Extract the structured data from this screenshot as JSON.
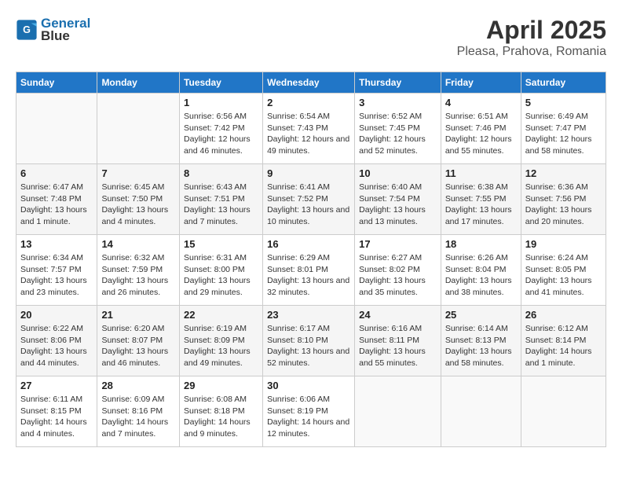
{
  "header": {
    "logo_line1": "General",
    "logo_line2": "Blue",
    "title": "April 2025",
    "subtitle": "Pleasa, Prahova, Romania"
  },
  "calendar": {
    "days_of_week": [
      "Sunday",
      "Monday",
      "Tuesday",
      "Wednesday",
      "Thursday",
      "Friday",
      "Saturday"
    ],
    "weeks": [
      [
        {
          "day": "",
          "info": ""
        },
        {
          "day": "",
          "info": ""
        },
        {
          "day": "1",
          "info": "Sunrise: 6:56 AM\nSunset: 7:42 PM\nDaylight: 12 hours and 46 minutes."
        },
        {
          "day": "2",
          "info": "Sunrise: 6:54 AM\nSunset: 7:43 PM\nDaylight: 12 hours and 49 minutes."
        },
        {
          "day": "3",
          "info": "Sunrise: 6:52 AM\nSunset: 7:45 PM\nDaylight: 12 hours and 52 minutes."
        },
        {
          "day": "4",
          "info": "Sunrise: 6:51 AM\nSunset: 7:46 PM\nDaylight: 12 hours and 55 minutes."
        },
        {
          "day": "5",
          "info": "Sunrise: 6:49 AM\nSunset: 7:47 PM\nDaylight: 12 hours and 58 minutes."
        }
      ],
      [
        {
          "day": "6",
          "info": "Sunrise: 6:47 AM\nSunset: 7:48 PM\nDaylight: 13 hours and 1 minute."
        },
        {
          "day": "7",
          "info": "Sunrise: 6:45 AM\nSunset: 7:50 PM\nDaylight: 13 hours and 4 minutes."
        },
        {
          "day": "8",
          "info": "Sunrise: 6:43 AM\nSunset: 7:51 PM\nDaylight: 13 hours and 7 minutes."
        },
        {
          "day": "9",
          "info": "Sunrise: 6:41 AM\nSunset: 7:52 PM\nDaylight: 13 hours and 10 minutes."
        },
        {
          "day": "10",
          "info": "Sunrise: 6:40 AM\nSunset: 7:54 PM\nDaylight: 13 hours and 13 minutes."
        },
        {
          "day": "11",
          "info": "Sunrise: 6:38 AM\nSunset: 7:55 PM\nDaylight: 13 hours and 17 minutes."
        },
        {
          "day": "12",
          "info": "Sunrise: 6:36 AM\nSunset: 7:56 PM\nDaylight: 13 hours and 20 minutes."
        }
      ],
      [
        {
          "day": "13",
          "info": "Sunrise: 6:34 AM\nSunset: 7:57 PM\nDaylight: 13 hours and 23 minutes."
        },
        {
          "day": "14",
          "info": "Sunrise: 6:32 AM\nSunset: 7:59 PM\nDaylight: 13 hours and 26 minutes."
        },
        {
          "day": "15",
          "info": "Sunrise: 6:31 AM\nSunset: 8:00 PM\nDaylight: 13 hours and 29 minutes."
        },
        {
          "day": "16",
          "info": "Sunrise: 6:29 AM\nSunset: 8:01 PM\nDaylight: 13 hours and 32 minutes."
        },
        {
          "day": "17",
          "info": "Sunrise: 6:27 AM\nSunset: 8:02 PM\nDaylight: 13 hours and 35 minutes."
        },
        {
          "day": "18",
          "info": "Sunrise: 6:26 AM\nSunset: 8:04 PM\nDaylight: 13 hours and 38 minutes."
        },
        {
          "day": "19",
          "info": "Sunrise: 6:24 AM\nSunset: 8:05 PM\nDaylight: 13 hours and 41 minutes."
        }
      ],
      [
        {
          "day": "20",
          "info": "Sunrise: 6:22 AM\nSunset: 8:06 PM\nDaylight: 13 hours and 44 minutes."
        },
        {
          "day": "21",
          "info": "Sunrise: 6:20 AM\nSunset: 8:07 PM\nDaylight: 13 hours and 46 minutes."
        },
        {
          "day": "22",
          "info": "Sunrise: 6:19 AM\nSunset: 8:09 PM\nDaylight: 13 hours and 49 minutes."
        },
        {
          "day": "23",
          "info": "Sunrise: 6:17 AM\nSunset: 8:10 PM\nDaylight: 13 hours and 52 minutes."
        },
        {
          "day": "24",
          "info": "Sunrise: 6:16 AM\nSunset: 8:11 PM\nDaylight: 13 hours and 55 minutes."
        },
        {
          "day": "25",
          "info": "Sunrise: 6:14 AM\nSunset: 8:13 PM\nDaylight: 13 hours and 58 minutes."
        },
        {
          "day": "26",
          "info": "Sunrise: 6:12 AM\nSunset: 8:14 PM\nDaylight: 14 hours and 1 minute."
        }
      ],
      [
        {
          "day": "27",
          "info": "Sunrise: 6:11 AM\nSunset: 8:15 PM\nDaylight: 14 hours and 4 minutes."
        },
        {
          "day": "28",
          "info": "Sunrise: 6:09 AM\nSunset: 8:16 PM\nDaylight: 14 hours and 7 minutes."
        },
        {
          "day": "29",
          "info": "Sunrise: 6:08 AM\nSunset: 8:18 PM\nDaylight: 14 hours and 9 minutes."
        },
        {
          "day": "30",
          "info": "Sunrise: 6:06 AM\nSunset: 8:19 PM\nDaylight: 14 hours and 12 minutes."
        },
        {
          "day": "",
          "info": ""
        },
        {
          "day": "",
          "info": ""
        },
        {
          "day": "",
          "info": ""
        }
      ]
    ]
  }
}
